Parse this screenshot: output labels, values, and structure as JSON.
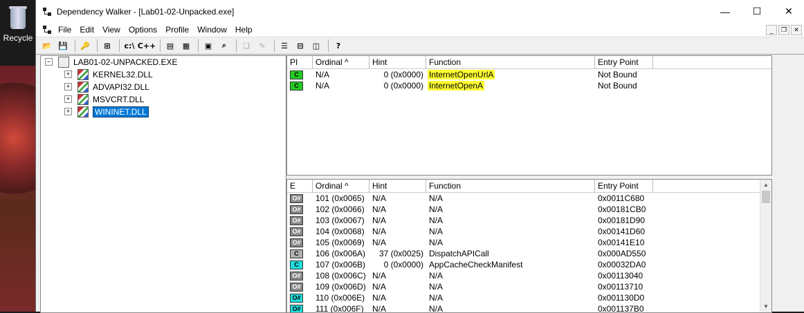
{
  "desktop": {
    "recycle_label": "Recycle"
  },
  "window": {
    "title": "Dependency Walker - [Lab01-02-Unpacked.exe]",
    "buttons": {
      "minimize": "—",
      "maximize": "☐",
      "close": "✕"
    }
  },
  "menu": [
    "File",
    "Edit",
    "View",
    "Options",
    "Profile",
    "Window",
    "Help"
  ],
  "toolbar": {
    "c_drive": "c:\\",
    "cpp": "C++"
  },
  "tree": {
    "root": "LAB01-02-UNPACKED.EXE",
    "children": [
      "KERNEL32.DLL",
      "ADVAPI32.DLL",
      "MSVCRT.DLL",
      "WININET.DLL"
    ],
    "selected": "WININET.DLL"
  },
  "imports": {
    "columns": [
      "PI",
      "Ordinal ^",
      "Hint",
      "Function",
      "Entry Point"
    ],
    "rows": [
      {
        "icon": "C",
        "ordinal": "N/A",
        "hint": "0 (0x0000)",
        "function": "InternetOpenUrlA",
        "entry": "Not Bound"
      },
      {
        "icon": "C",
        "ordinal": "N/A",
        "hint": "0 (0x0000)",
        "function": "InternetOpenA",
        "entry": "Not Bound"
      }
    ]
  },
  "exports": {
    "columns": [
      "E",
      "Ordinal ^",
      "Hint",
      "Function",
      "Entry Point"
    ],
    "rows": [
      {
        "icon": "O#",
        "style": "gray",
        "ordinal": "101 (0x0065)",
        "hint": "N/A",
        "function": "N/A",
        "entry": "0x0011C680"
      },
      {
        "icon": "O#",
        "style": "gray",
        "ordinal": "102 (0x0066)",
        "hint": "N/A",
        "function": "N/A",
        "entry": "0x00181CB0"
      },
      {
        "icon": "O#",
        "style": "gray",
        "ordinal": "103 (0x0067)",
        "hint": "N/A",
        "function": "N/A",
        "entry": "0x00181D90"
      },
      {
        "icon": "O#",
        "style": "gray",
        "ordinal": "104 (0x0068)",
        "hint": "N/A",
        "function": "N/A",
        "entry": "0x00141D60"
      },
      {
        "icon": "O#",
        "style": "gray",
        "ordinal": "105 (0x0069)",
        "hint": "N/A",
        "function": "N/A",
        "entry": "0x00141E10"
      },
      {
        "icon": "C",
        "style": "grayc",
        "ordinal": "106 (0x006A)",
        "hint": "37 (0x0025)",
        "function": "DispatchAPICall",
        "entry": "0x000AD550"
      },
      {
        "icon": "C",
        "style": "cyan",
        "ordinal": "107 (0x006B)",
        "hint": "0 (0x0000)",
        "function": "AppCacheCheckManifest",
        "entry": "0x00032DA0"
      },
      {
        "icon": "O#",
        "style": "gray",
        "ordinal": "108 (0x006C)",
        "hint": "N/A",
        "function": "N/A",
        "entry": "0x00113040"
      },
      {
        "icon": "O#",
        "style": "gray",
        "ordinal": "109 (0x006D)",
        "hint": "N/A",
        "function": "N/A",
        "entry": "0x00113710"
      },
      {
        "icon": "O#",
        "style": "cyan",
        "ordinal": "110 (0x006E)",
        "hint": "N/A",
        "function": "N/A",
        "entry": "0x001130D0"
      },
      {
        "icon": "O#",
        "style": "cyan",
        "ordinal": "111 (0x006F)",
        "hint": "N/A",
        "function": "N/A",
        "entry": "0x001137B0"
      }
    ]
  }
}
